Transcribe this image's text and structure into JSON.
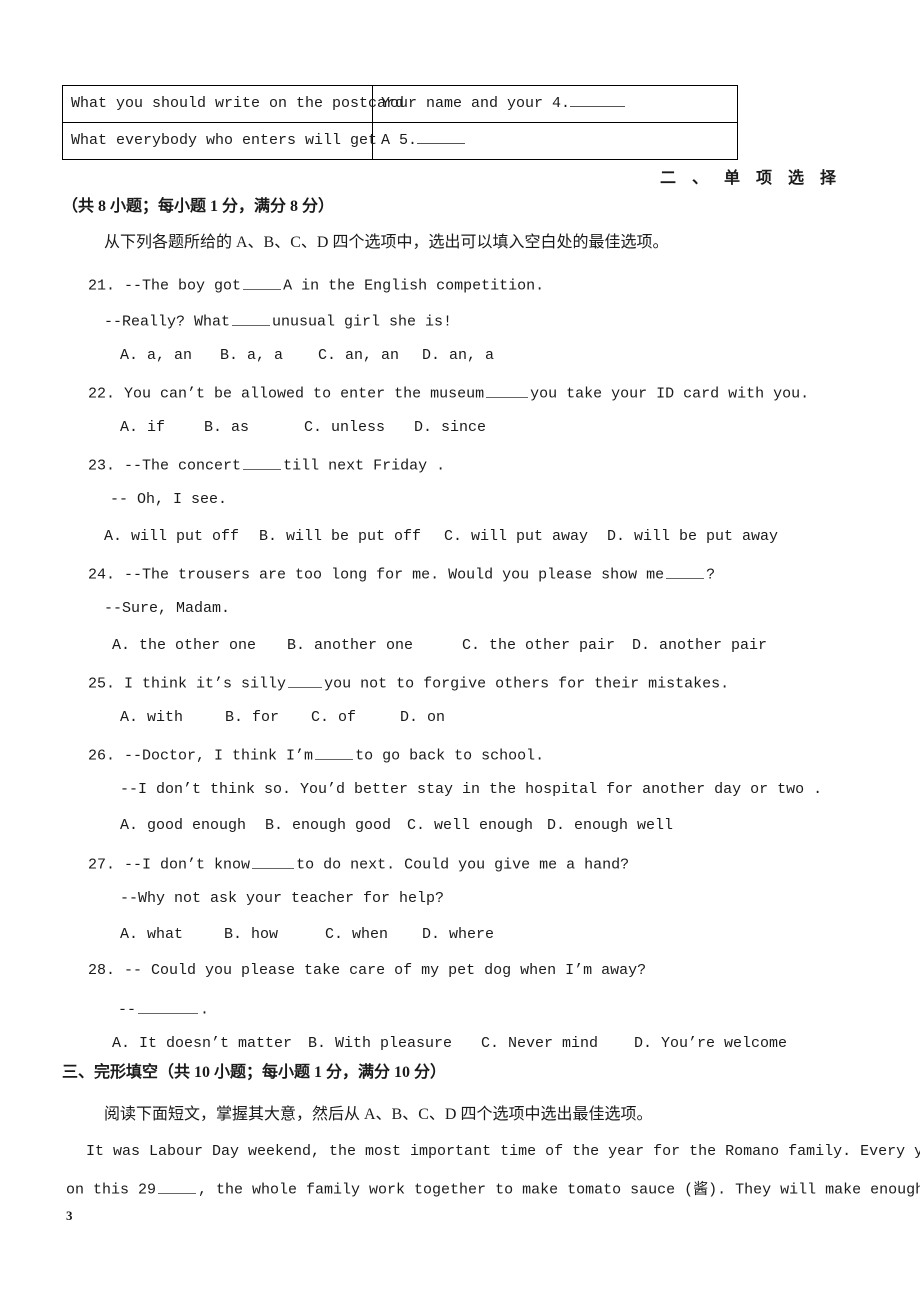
{
  "document": {
    "page_number": "3",
    "table": {
      "rows": [
        {
          "prompt": "What you should write on the postcard",
          "answer_prefix": "Your name and your 4."
        },
        {
          "prompt": "What everybody who enters will get",
          "answer_prefix": "A 5."
        }
      ]
    },
    "section_two": {
      "heading": "二 、 单 项 选 择",
      "score_note": "（共 8 小题；每小题 1 分，满分 8 分）",
      "instruction": "从下列各题所给的 A、B、C、D 四个选项中，选出可以填入空白处的最佳选项。",
      "questions": [
        {
          "number": "21.",
          "stem_a": "--The boy got",
          "stem_b": "A in the English competition.",
          "stem2_a": "--Really? What",
          "stem2_b": "unusual girl she is!",
          "options": [
            "A. a, an",
            "B. a, a",
            "C. an, an",
            "D. an, a"
          ]
        },
        {
          "number": "22.",
          "stem_a": "You can’t be allowed to enter the museum",
          "stem_b": "you take your ID card with you.",
          "options": [
            "A. if",
            "B. as",
            "C. unless",
            "D. since"
          ]
        },
        {
          "number": "23.",
          "stem_a": "--The concert",
          "stem_b": "till next Friday .",
          "stem2": "-- Oh, I see.",
          "options": [
            "A. will put off",
            "B. will be put off",
            "C. will put away",
            "D. will be put away"
          ]
        },
        {
          "number": "24.",
          "stem_a": "--The trousers are too long for me. Would you please show me",
          "stem_b": "?",
          "stem2": "--Sure, Madam.",
          "options": [
            "A. the other one",
            "B. another one",
            "C. the other pair",
            "D. another pair"
          ]
        },
        {
          "number": "25.",
          "stem_a": "I think it’s silly",
          "stem_b": "you not to forgive others for their mistakes.",
          "options": [
            "A. with",
            "B. for",
            "C. of",
            "D. on"
          ]
        },
        {
          "number": "26.",
          "stem_a": "--Doctor, I think I’m",
          "stem_b": "to go back to school.",
          "stem2": "--I don’t think so. You’d better stay in the hospital for another day or two .",
          "options": [
            "A. good enough",
            "B. enough good",
            "C. well enough",
            "D. enough well"
          ]
        },
        {
          "number": "27.",
          "stem_a": "--I don’t know",
          "stem_b": "to do next. Could you give me a hand?",
          "stem2": "--Why not ask your teacher for help?",
          "options": [
            "A. what",
            "B. how",
            "C. when",
            "D. where"
          ]
        },
        {
          "number": "28.",
          "stem_a": "-- Could you please take care of my pet dog when I’m away?",
          "stem2_a": "--",
          "stem2_b": ".",
          "options": [
            "A. It doesn’t matter",
            "B. With pleasure",
            "C. Never mind",
            "D. You’re welcome"
          ]
        }
      ]
    },
    "section_three": {
      "heading": "三、完形填空（共 10 小题；每小题 1 分，满分 10 分）",
      "instruction": "阅读下面短文，掌握其大意，然后从 A、B、C、D 四个选项中选出最佳选项。",
      "passage_line1": "It was Labour Day weekend, the most important time of the year for the Romano family. Every year",
      "passage_line2_a": "on this 29",
      "passage_line2_b": ", the whole family work together to make tomato sauce (酱). They will make enough"
    }
  }
}
